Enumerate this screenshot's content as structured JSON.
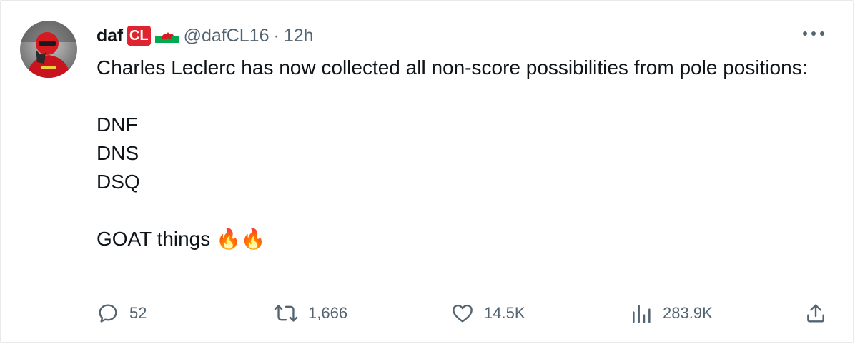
{
  "tweet": {
    "author": {
      "display_name": "daf",
      "badge_text": "CL",
      "flag_icon": "wales-flag-icon",
      "handle": "@dafCL16"
    },
    "separator": "·",
    "time": "12h",
    "text": "Charles Leclerc has now collected all non-score possibilities from pole positions:\n\nDNF\nDNS\nDSQ\n\nGOAT things 🔥🔥",
    "stats": {
      "replies": "52",
      "reposts": "1,666",
      "likes": "14.5K",
      "views": "283.9K"
    }
  },
  "colors": {
    "text": "#0f1419",
    "secondary": "#536471",
    "badge": "#e0242f",
    "border": "#e7e9ea"
  },
  "icons": [
    "more-icon",
    "reply-icon",
    "repost-icon",
    "like-icon",
    "views-icon",
    "share-icon"
  ]
}
